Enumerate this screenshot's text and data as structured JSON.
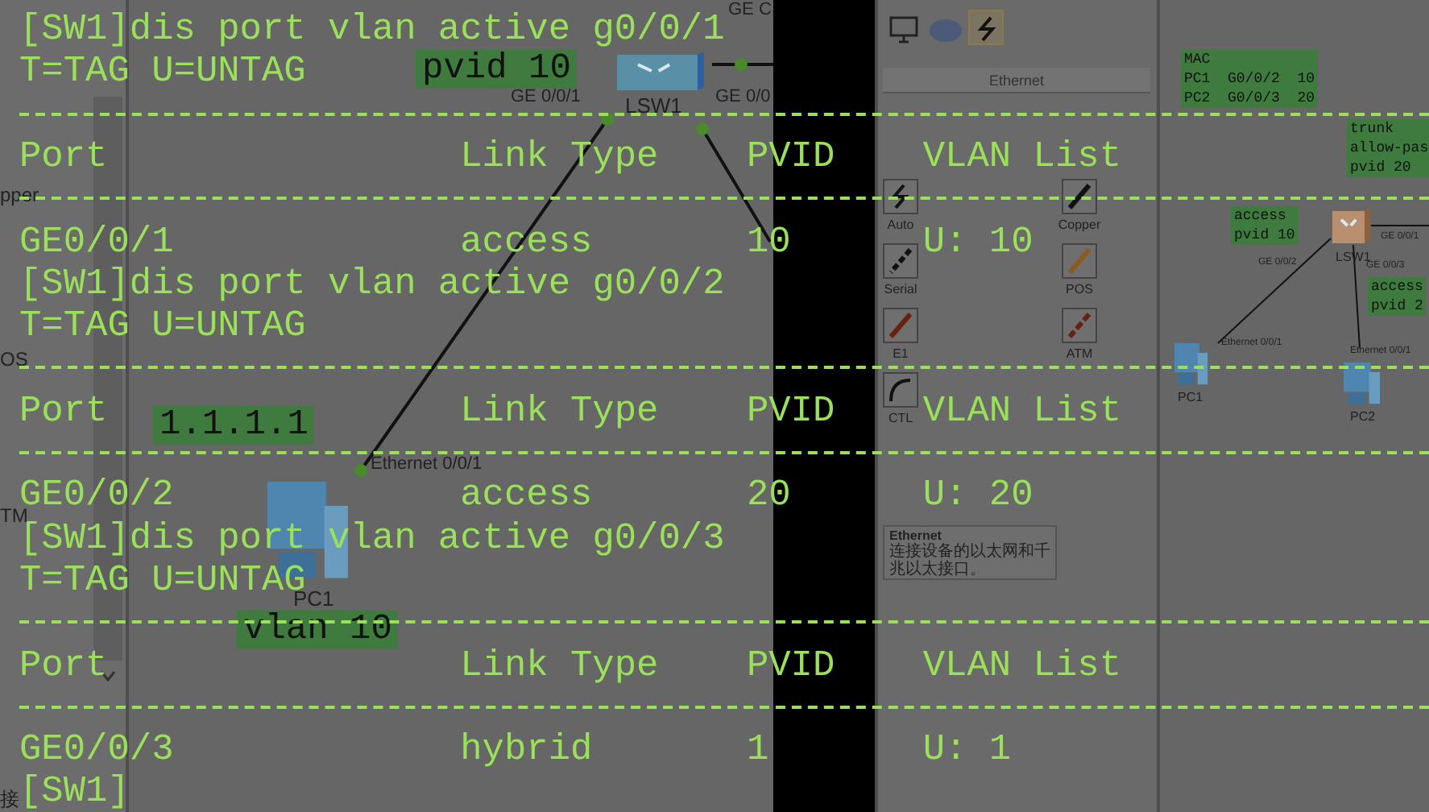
{
  "terminal": {
    "lines": [
      {
        "kind": "text",
        "text": "[SW1]dis port vlan active g0/0/1"
      },
      {
        "kind": "text",
        "text": "T=TAG U=UNTAG"
      },
      {
        "kind": "rule"
      },
      {
        "kind": "row",
        "cells": [
          "Port",
          "Link Type",
          "PVID",
          "VLAN List"
        ]
      },
      {
        "kind": "rule"
      },
      {
        "kind": "row",
        "cells": [
          "GE0/0/1",
          "access",
          "10",
          "U: 10"
        ]
      },
      {
        "kind": "text",
        "text": "[SW1]dis port vlan active g0/0/2"
      },
      {
        "kind": "text",
        "text": "T=TAG U=UNTAG"
      },
      {
        "kind": "rule"
      },
      {
        "kind": "row",
        "cells": [
          "Port",
          "Link Type",
          "PVID",
          "VLAN List"
        ]
      },
      {
        "kind": "rule"
      },
      {
        "kind": "row",
        "cells": [
          "GE0/0/2",
          "access",
          "20",
          "U: 20"
        ]
      },
      {
        "kind": "text",
        "text": "[SW1]dis port vlan active g0/0/3"
      },
      {
        "kind": "text",
        "text": "T=TAG U=UNTAG"
      },
      {
        "kind": "rule"
      },
      {
        "kind": "row",
        "cells": [
          "Port",
          "Link Type",
          "PVID",
          "VLAN List"
        ]
      },
      {
        "kind": "rule"
      },
      {
        "kind": "row",
        "cells": [
          "GE0/0/3",
          "hybrid",
          "1",
          "U: 1"
        ]
      },
      {
        "kind": "text",
        "text": "[SW1]"
      }
    ]
  },
  "left_panel": {
    "labels": [
      "pper",
      "OS",
      "TM",
      "接"
    ]
  },
  "canvas": {
    "notes": [
      "pvid 10",
      "1.1.1.1",
      "vlan 10"
    ],
    "port_labels": [
      "GE C",
      "GE 0/0/1",
      "GE 0/0",
      "Ethernet 0/0/1"
    ],
    "devices": [
      {
        "kind": "switch",
        "label": "LSW1"
      },
      {
        "kind": "pc",
        "label": "PC1"
      }
    ]
  },
  "device_panel": {
    "categories": [
      {
        "kind": "pc",
        "selected": false
      },
      {
        "kind": "cloud",
        "selected": false
      },
      {
        "kind": "cable",
        "selected": true
      }
    ],
    "section": "Ethernet",
    "cables": [
      {
        "kind": "auto",
        "label": "Auto"
      },
      {
        "kind": "copper",
        "label": "Copper"
      },
      {
        "kind": "serial",
        "label": "Serial"
      },
      {
        "kind": "pos",
        "label": "POS"
      },
      {
        "kind": "e1",
        "label": "E1"
      },
      {
        "kind": "atm",
        "label": "ATM"
      },
      {
        "kind": "ctl",
        "label": "CTL"
      }
    ],
    "tooltip": {
      "title": "Ethernet",
      "text": "连接设备的以太网和千兆以太接口。"
    }
  },
  "mini_topology": {
    "notes": [
      [
        "MAC",
        "PC1  G0/0/2  10",
        "PC2  G0/0/3  20"
      ],
      [
        "trunk",
        "allow-pas",
        "pvid 20"
      ],
      [
        "access",
        "pvid 10"
      ],
      [
        "access",
        "pvid 2"
      ]
    ],
    "port_labels": [
      "GE 0/0/1",
      "GE 0/0/2",
      "GE 0/0/3",
      "Ethernet 0/0/1",
      "Ethernet 0/0/1"
    ],
    "devices": [
      {
        "kind": "switch",
        "label": "LSW1"
      },
      {
        "kind": "pc",
        "label": "PC1"
      },
      {
        "kind": "pc",
        "label": "PC2"
      }
    ]
  }
}
